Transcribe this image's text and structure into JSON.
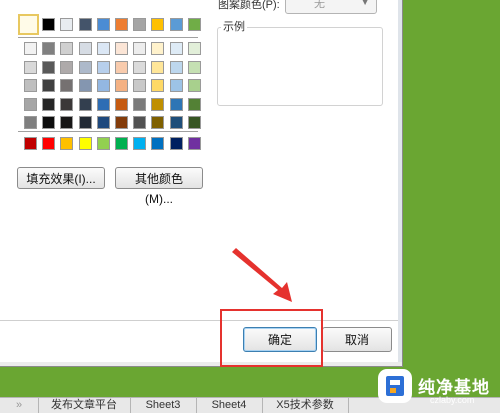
{
  "dialog": {
    "pattern_color_label": "图案颜色(P):",
    "pattern_color_value": "无",
    "sample_label": "示例",
    "fill_effects_button": "填充效果(I)...",
    "more_colors_button": "其他颜色(M)...",
    "ok_button": "确定",
    "cancel_button": "取消"
  },
  "palette": {
    "no_color_selected": true,
    "theme_row": [
      "#ffffff",
      "#000000",
      "#e8ecf0",
      "#44546a",
      "#4b8cd4",
      "#ed7d31",
      "#a5a5a5",
      "#ffc000",
      "#5b9bd5",
      "#70ad47"
    ],
    "tint_rows": [
      [
        "#f2f2f2",
        "#808080",
        "#d0d0d0",
        "#d6dce4",
        "#dbe7f5",
        "#fbe5d6",
        "#ededed",
        "#fff2cc",
        "#deebf6",
        "#e2efd9"
      ],
      [
        "#d9d9d9",
        "#595959",
        "#aeaaaa",
        "#adb9ca",
        "#b7cfec",
        "#f8cbad",
        "#dbdbdb",
        "#ffe699",
        "#bdd7ee",
        "#c5e0b3"
      ],
      [
        "#bfbfbf",
        "#404040",
        "#757171",
        "#8496b0",
        "#93b7e2",
        "#f4b183",
        "#c9c9c9",
        "#ffd966",
        "#9dc3e6",
        "#a8d08d"
      ],
      [
        "#a6a6a6",
        "#262626",
        "#3b3838",
        "#333f4f",
        "#2e6db4",
        "#c55a11",
        "#7b7b7b",
        "#bf8f00",
        "#2e75b5",
        "#538135"
      ],
      [
        "#7f7f7f",
        "#0d0d0d",
        "#171616",
        "#222a35",
        "#1f497d",
        "#833c0b",
        "#525252",
        "#7f6000",
        "#1e4e79",
        "#375623"
      ]
    ],
    "standard_row": [
      "#c00000",
      "#ff0000",
      "#ffc000",
      "#ffff00",
      "#92d050",
      "#00b050",
      "#00b0f0",
      "#0070c0",
      "#002060",
      "#7030a0"
    ]
  },
  "sheet_tabs": [
    "发布文章平台",
    "Sheet3",
    "Sheet4",
    "X5技术参数"
  ],
  "watermark": {
    "title": "纯净基地",
    "url": "czlaby.com"
  }
}
